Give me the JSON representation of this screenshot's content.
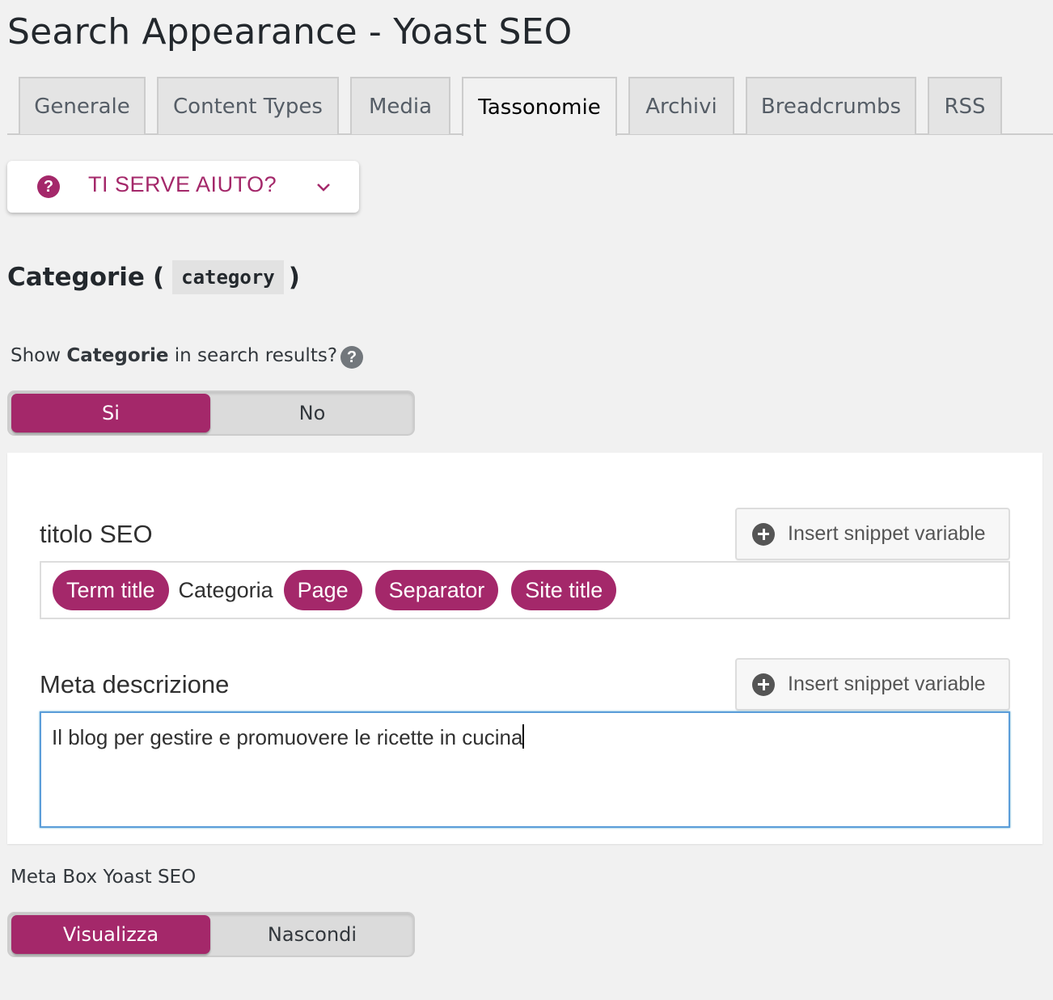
{
  "page": {
    "title": "Search Appearance - Yoast SEO"
  },
  "tabs": [
    {
      "label": "Generale",
      "active": false
    },
    {
      "label": "Content Types",
      "active": false
    },
    {
      "label": "Media",
      "active": false
    },
    {
      "label": "Tassonomie",
      "active": true
    },
    {
      "label": "Archivi",
      "active": false
    },
    {
      "label": "Breadcrumbs",
      "active": false
    },
    {
      "label": "RSS",
      "active": false
    }
  ],
  "help": {
    "label": "TI SERVE AIUTO?",
    "icon": "question-circle-icon",
    "chevron": "chevron-down-icon"
  },
  "section": {
    "title": "Categorie",
    "open_paren": "(",
    "slug": "category",
    "close_paren": ")"
  },
  "show_in_search": {
    "prefix": "Show ",
    "bold": "Categorie",
    "suffix": " in search results?",
    "help_icon": "?",
    "options": [
      "Si",
      "No"
    ],
    "selected": "Si"
  },
  "seo_title": {
    "label": "titolo SEO",
    "button_label": "Insert snippet variable",
    "parts": [
      {
        "type": "variable",
        "text": "Term title"
      },
      {
        "type": "text",
        "text": "Categoria"
      },
      {
        "type": "variable",
        "text": "Page"
      },
      {
        "type": "variable",
        "text": "Separator"
      },
      {
        "type": "variable",
        "text": "Site title"
      }
    ]
  },
  "meta_description": {
    "label": "Meta descrizione",
    "button_label": "Insert snippet variable",
    "value": "Il blog per gestire e promuovere le ricette in cucina"
  },
  "meta_box": {
    "label": "Meta Box Yoast SEO",
    "options": [
      "Visualizza",
      "Nascondi"
    ],
    "selected": "Visualizza"
  },
  "colors": {
    "accent": "#a4286a",
    "background": "#f1f1f1",
    "focus_border": "#5b9dd9"
  }
}
